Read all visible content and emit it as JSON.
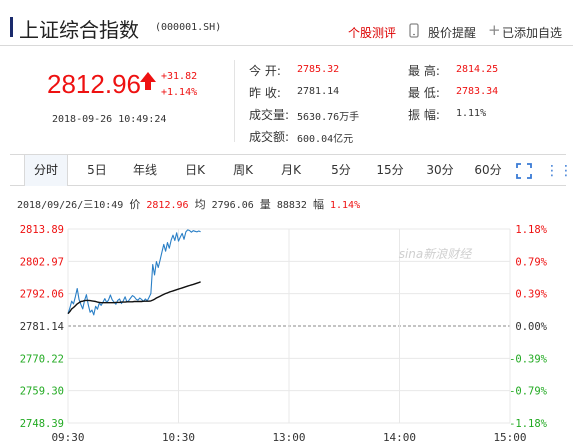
{
  "header": {
    "stock_name": "上证综合指数",
    "stock_code": "(000001.SH)",
    "rating_link": "个股测评",
    "alert_link": "股价提醒",
    "add_link": "已添加自选",
    "alert_icon": "phone-icon",
    "add_icon": "plus-icon"
  },
  "quote": {
    "price": "2812.96",
    "change": "+31.82",
    "change_pct": "+1.14%",
    "datetime": "2018-09-26 10:49:24",
    "direction_icon": "up-arrow-icon",
    "color_up": "#ee1111"
  },
  "details": {
    "open_label": "今  开:",
    "open_value": "2785.32",
    "prev_close_label": "昨  收:",
    "prev_close_value": "2781.14",
    "volume_label": "成交量:",
    "volume_value": "5630.76万手",
    "amount_label": "成交额:",
    "amount_value": "600.04亿元",
    "high_label": "最  高:",
    "high_value": "2814.25",
    "low_label": "最  低:",
    "low_value": "2783.34",
    "amplitude_label": "振  幅:",
    "amplitude_value": "1.11%"
  },
  "tabs": [
    {
      "label": "分时",
      "active": true
    },
    {
      "label": "5日"
    },
    {
      "label": "年线"
    },
    {
      "label": "日K"
    },
    {
      "label": "周K"
    },
    {
      "label": "月K"
    },
    {
      "label": "5分"
    },
    {
      "label": "15分"
    },
    {
      "label": "30分"
    },
    {
      "label": "60分"
    }
  ],
  "status_bar": {
    "date": "2018/09/26/三10:49",
    "price_label": "价",
    "price_value": "2812.96",
    "avg_label": "均",
    "avg_value": "2796.06",
    "volume_label": "量",
    "volume_value": "88832",
    "pct_label": "幅",
    "pct_value": "1.14%"
  },
  "chart_data": {
    "type": "line",
    "title": "",
    "watermark": "sina新浪财经",
    "base": 2781.14,
    "ylim": [
      2748.39,
      2813.89
    ],
    "y_ticks_left": [
      "2813.89",
      "2802.97",
      "2792.06",
      "2781.14",
      "2770.22",
      "2759.30",
      "2748.39"
    ],
    "y_ticks_right": [
      "1.18%",
      "0.79%",
      "0.39%",
      "0.00%",
      "-0.39%",
      "-0.79%",
      "-1.18%"
    ],
    "x_ticks": [
      "09:30",
      "10:30",
      "13:00",
      "14:00",
      "15:00"
    ],
    "total_minutes": 240,
    "series": [
      {
        "name": "价",
        "color": "#2a7fc6",
        "values": [
          2785.3,
          2787.2,
          2789.5,
          2788.6,
          2791.0,
          2793.8,
          2790.1,
          2788.4,
          2786.9,
          2789.8,
          2791.7,
          2788.3,
          2785.8,
          2786.5,
          2784.9,
          2787.8,
          2786.8,
          2788.9,
          2788.1,
          2789.2,
          2790.4,
          2789.1,
          2789.9,
          2791.6,
          2790.0,
          2789.2,
          2788.5,
          2789.8,
          2790.3,
          2788.7,
          2789.6,
          2791.0,
          2789.2,
          2789.7,
          2790.6,
          2791.4,
          2791.0,
          2790.2,
          2789.9,
          2790.6,
          2790.1,
          2789.4,
          2790.3,
          2789.6,
          2790.8,
          2792.1,
          2801.9,
          2798.4,
          2802.9,
          2800.9,
          2803.4,
          2806.1,
          2808.7,
          2806.4,
          2809.3,
          2807.4,
          2810.1,
          2811.8,
          2810.0,
          2812.6,
          2809.8,
          2811.2,
          2812.4,
          2810.4,
          2812.9,
          2813.6,
          2813.4,
          2812.8,
          2813.3,
          2813.1,
          2812.9,
          2813.2,
          2812.96
        ]
      },
      {
        "name": "均",
        "color": "#111111",
        "values": [
          2785.3,
          2786.0,
          2786.9,
          2787.4,
          2788.0,
          2788.6,
          2789.0,
          2789.4,
          2789.5,
          2789.7,
          2789.8,
          2789.8,
          2789.7,
          2789.6,
          2789.5,
          2789.4,
          2789.2,
          2789.1,
          2789.0,
          2789.0,
          2789.0,
          2789.0,
          2789.0,
          2789.0,
          2789.0,
          2789.0,
          2789.1,
          2789.1,
          2789.1,
          2789.2,
          2789.2,
          2789.2,
          2789.3,
          2789.3,
          2789.3,
          2789.3,
          2789.4,
          2789.4,
          2789.4,
          2789.4,
          2789.4,
          2789.5,
          2789.5,
          2789.5,
          2789.5,
          2789.6,
          2789.9,
          2790.2,
          2790.6,
          2790.9,
          2791.2,
          2791.5,
          2791.8,
          2792.1,
          2792.3,
          2792.6,
          2792.8,
          2793.0,
          2793.2,
          2793.4,
          2793.6,
          2793.8,
          2794.0,
          2794.2,
          2794.4,
          2794.6,
          2794.8,
          2795.0,
          2795.2,
          2795.4,
          2795.6,
          2795.8,
          2796.06
        ]
      }
    ],
    "grid": true,
    "colors": {
      "up": "#ee1111",
      "down": "#22aa22",
      "neutral": "#333333",
      "grid": "#e8e8e8"
    }
  }
}
